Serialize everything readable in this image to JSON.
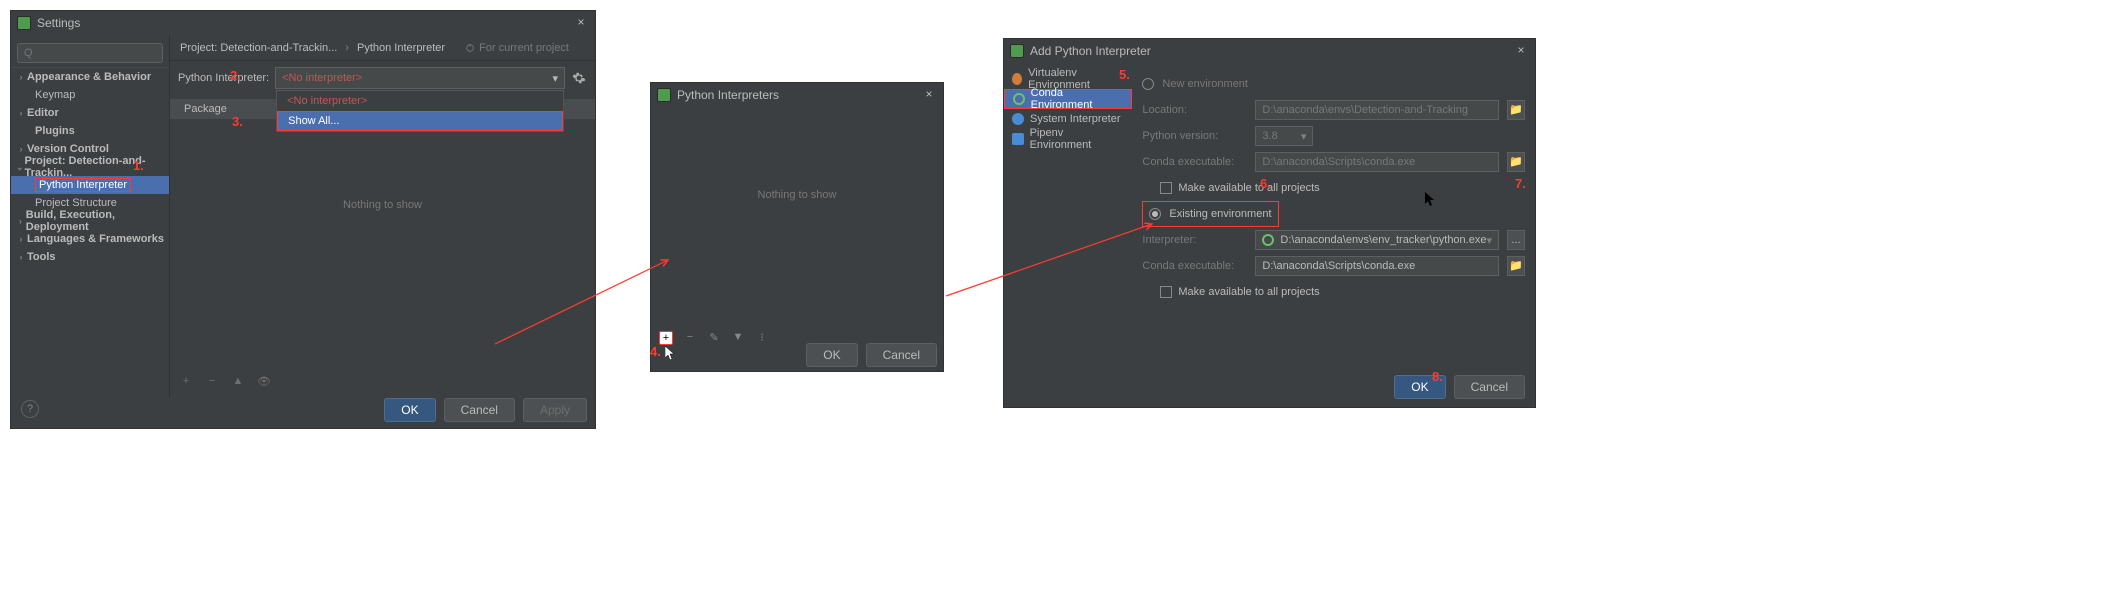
{
  "colors": {
    "accent_red": "#ff3b30",
    "primary_btn": "#365880",
    "selection": "#4b6eaf"
  },
  "annotations": {
    "n1": "1.",
    "n2": "2.",
    "n3": "3.",
    "n4": "4.",
    "n5": "5.",
    "n6": "6.",
    "n7": "7.",
    "n8": "8."
  },
  "dialog1": {
    "title": "Settings",
    "search_placeholder": "Q",
    "tree": {
      "appearance": "Appearance & Behavior",
      "keymap": "Keymap",
      "editor": "Editor",
      "plugins": "Plugins",
      "vcs": "Version Control",
      "project": "Project: Detection-and-Trackin...",
      "python_interp": "Python Interpreter",
      "project_struct": "Project Structure",
      "build": "Build, Execution, Deployment",
      "lang_fw": "Languages & Frameworks",
      "tools": "Tools"
    },
    "crumbs": {
      "a": "Project: Detection-and-Trackin...",
      "b": "Python Interpreter",
      "hint": "For current project"
    },
    "interpreter_label": "Python Interpreter:",
    "interpreter_value": "<No interpreter>",
    "dropdown": {
      "no_interp": "<No interpreter>",
      "show_all": "Show All..."
    },
    "pkg_header": "Package",
    "pkg_empty": "Nothing to show",
    "buttons": {
      "ok": "OK",
      "cancel": "Cancel",
      "apply": "Apply"
    }
  },
  "dialog2": {
    "title": "Python Interpreters",
    "empty": "Nothing to show",
    "buttons": {
      "ok": "OK",
      "cancel": "Cancel"
    }
  },
  "dialog3": {
    "title": "Add Python Interpreter",
    "side": {
      "venv": "Virtualenv Environment",
      "conda": "Conda Environment",
      "sys": "System Interpreter",
      "pipenv": "Pipenv Environment"
    },
    "form": {
      "new_env": "New environment",
      "location_label": "Location:",
      "location_value": "D:\\anaconda\\envs\\Detection-and-Tracking",
      "pyver_label": "Python version:",
      "pyver_value": "3.8",
      "conda_exe_label": "Conda executable:",
      "conda_exe_value": "D:\\anaconda\\Scripts\\conda.exe",
      "make_avail": "Make available to all projects",
      "existing_env": "Existing environment",
      "interp_label": "Interpreter:",
      "interp_value": "D:\\anaconda\\envs\\env_tracker\\python.exe",
      "conda_exe2_value": "D:\\anaconda\\Scripts\\conda.exe"
    },
    "buttons": {
      "ok": "OK",
      "cancel": "Cancel"
    }
  }
}
